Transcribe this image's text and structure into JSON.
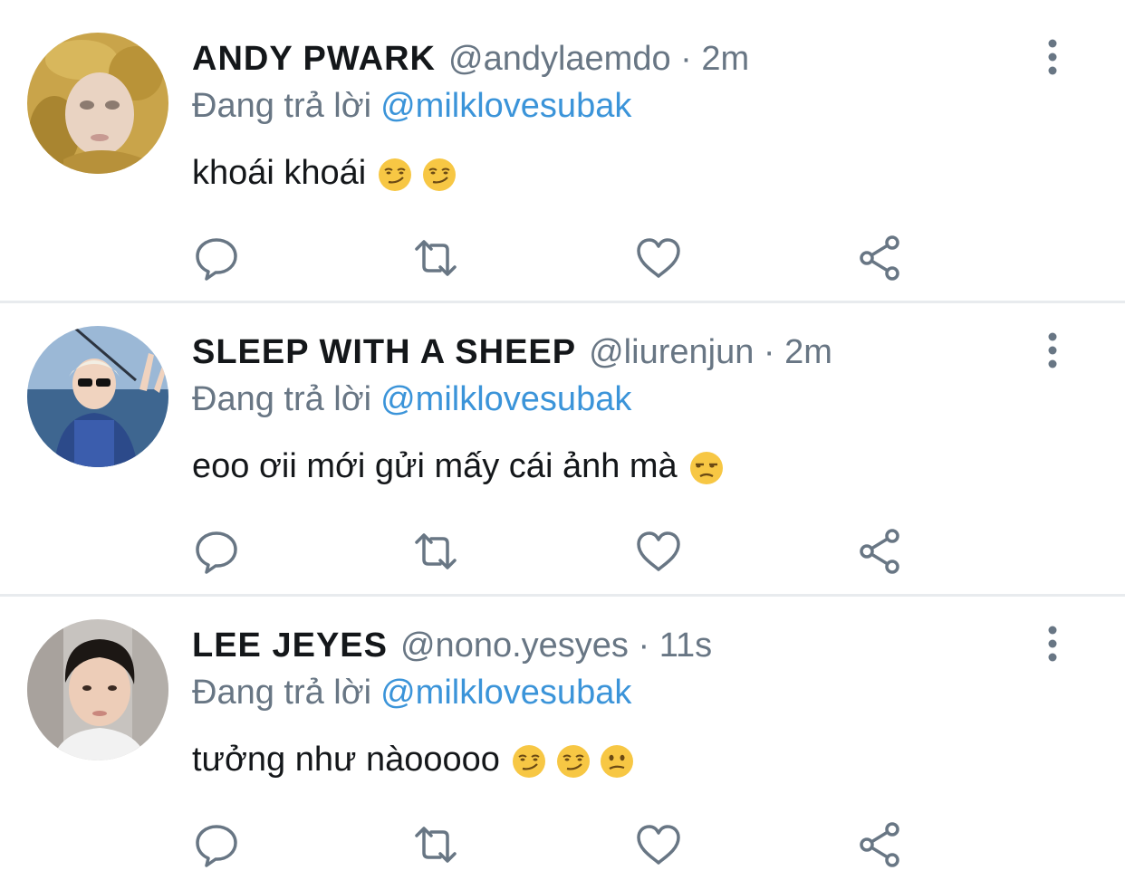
{
  "tweets": [
    {
      "display_name": "ANDY PWARK",
      "handle": "@andylaemdo",
      "separator": "·",
      "time": "2m",
      "replying_prefix": "Đang trả lời",
      "replying_to": "@milklovesubak",
      "text": "khoái khoái",
      "emojis": [
        "smirking-face",
        "smirking-face"
      ]
    },
    {
      "display_name": "SLEEP WITH A SHEEP",
      "handle": "@liurenjun",
      "separator": "·",
      "time": "2m",
      "replying_prefix": "Đang trả lời",
      "replying_to": "@milklovesubak",
      "text": "eoo ơii mới gửi mấy cái ảnh mà",
      "emojis": [
        "unamused-face"
      ]
    },
    {
      "display_name": "LEE JEYES",
      "handle": "@nono.yesyes",
      "separator": "·",
      "time": "11s",
      "replying_prefix": "Đang trả lời",
      "replying_to": "@milklovesubak",
      "text": "tưởng như nàooooo",
      "emojis": [
        "smirking-face",
        "smirking-face",
        "confused-face"
      ]
    }
  ],
  "actions": [
    "reply-icon",
    "retweet-icon",
    "like-icon",
    "share-icon"
  ],
  "colors": {
    "text": "#14171a",
    "muted": "#687684",
    "link": "#3b94d9",
    "icon": "#687684",
    "divider": "#e8ebee"
  }
}
